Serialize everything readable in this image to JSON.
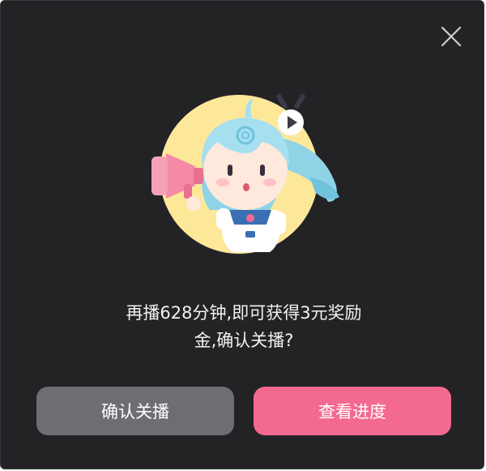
{
  "dialog": {
    "close_icon": "close-icon",
    "message_line1": "再播628分钟,即可获得3元奖励",
    "message_line2": "金,确认关播?",
    "confirm_button": "确认关播",
    "progress_button": "查看进度",
    "colors": {
      "background": "#232326",
      "confirm_button": "#6d6e74",
      "progress_button": "#f4698f",
      "illustration_circle": "#fde89a"
    }
  }
}
